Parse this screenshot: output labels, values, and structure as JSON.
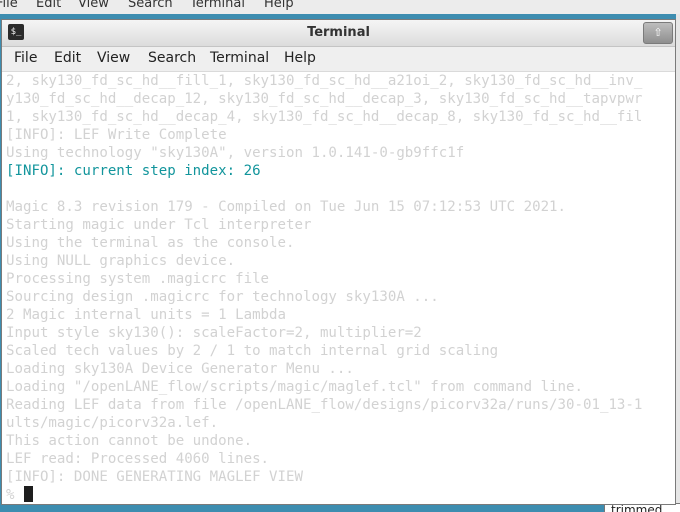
{
  "background_app": {
    "menu": [
      "File",
      "Edit",
      "View",
      "Search",
      "Terminal",
      "Help"
    ]
  },
  "taskbar": {
    "label": "trimmed"
  },
  "window": {
    "title": "Terminal",
    "titlebar_button": "⇧",
    "icon_glyph": "$_",
    "menu": {
      "file": "File",
      "edit": "Edit",
      "view": "View",
      "search": "Search",
      "terminal": "Terminal",
      "help": "Help"
    }
  },
  "terminal": {
    "lines": [
      {
        "text": "2, sky130_fd_sc_hd__fill_1, sky130_fd_sc_hd__a21oi_2, sky130_fd_sc_hd__inv_",
        "style": "dim"
      },
      {
        "text": "y130_fd_sc_hd__decap_12, sky130_fd_sc_hd__decap_3, sky130_fd_sc_hd__tapvpwr",
        "style": "dim"
      },
      {
        "text": "1, sky130_fd_sc_hd__decap_4, sky130_fd_sc_hd__decap_8, sky130_fd_sc_hd__fil",
        "style": "dim"
      },
      {
        "text": "[INFO]: LEF Write Complete",
        "style": "dim"
      },
      {
        "text": "Using technology \"sky130A\", version 1.0.141-0-gb9ffc1f",
        "style": "dim"
      },
      {
        "text": "[INFO]: current step index: 26",
        "style": "info"
      },
      {
        "text": "",
        "style": "dim"
      },
      {
        "text": "Magic 8.3 revision 179 - Compiled on Tue Jun 15 07:12:53 UTC 2021.",
        "style": "dim"
      },
      {
        "text": "Starting magic under Tcl interpreter",
        "style": "dim"
      },
      {
        "text": "Using the terminal as the console.",
        "style": "dim"
      },
      {
        "text": "Using NULL graphics device.",
        "style": "dim"
      },
      {
        "text": "Processing system .magicrc file",
        "style": "dim"
      },
      {
        "text": "Sourcing design .magicrc for technology sky130A ...",
        "style": "dim"
      },
      {
        "text": "2 Magic internal units = 1 Lambda",
        "style": "dim"
      },
      {
        "text": "Input style sky130(): scaleFactor=2, multiplier=2",
        "style": "dim"
      },
      {
        "text": "Scaled tech values by 2 / 1 to match internal grid scaling",
        "style": "dim"
      },
      {
        "text": "Loading sky130A Device Generator Menu ...",
        "style": "dim"
      },
      {
        "text": "Loading \"/openLANE_flow/scripts/magic/maglef.tcl\" from command line.",
        "style": "dim"
      },
      {
        "text": "Reading LEF data from file /openLANE_flow/designs/picorv32a/runs/30-01_13-1",
        "style": "dim"
      },
      {
        "text": "ults/magic/picorv32a.lef.",
        "style": "dim"
      },
      {
        "text": "This action cannot be undone.",
        "style": "dim"
      },
      {
        "text": "LEF read: Processed 4060 lines.",
        "style": "dim"
      },
      {
        "text": "[INFO]: DONE GENERATING MAGLEF VIEW",
        "style": "dim"
      }
    ],
    "prompt": "%"
  }
}
